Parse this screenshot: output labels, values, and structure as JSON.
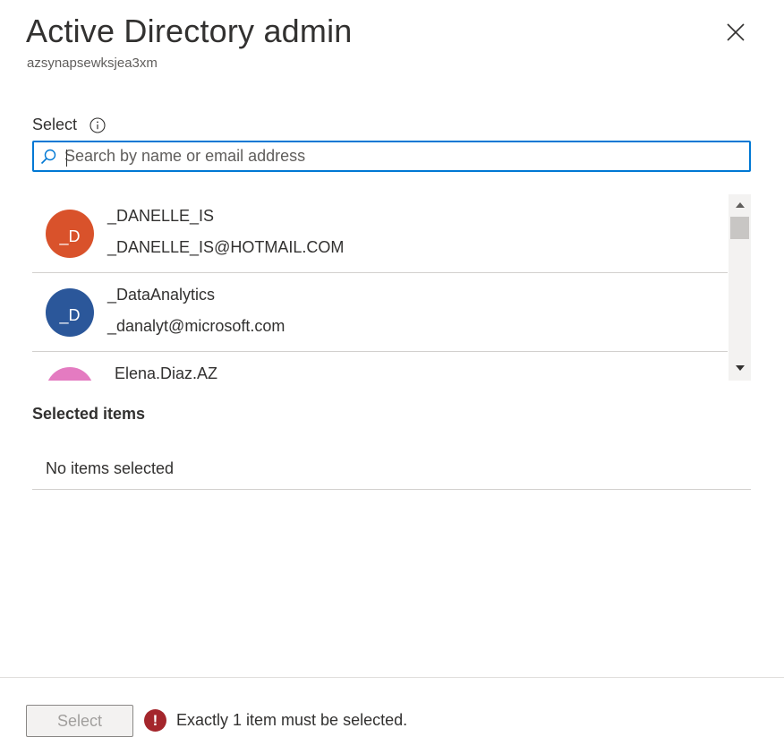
{
  "header": {
    "title": "Active Directory admin",
    "subtitle": "azsynapsewksjea3xm"
  },
  "picker": {
    "label": "Select",
    "search_placeholder": "Search by name or email address",
    "results": [
      {
        "initials": "_D",
        "name": "_DANELLE_IS",
        "email": "_DANELLE_IS@HOTMAIL.COM",
        "color": "#d9522b"
      },
      {
        "initials": "_D",
        "name": "_DataAnalytics",
        "email": "_danalyt@microsoft.com",
        "color": "#2b579a"
      },
      {
        "initials": "",
        "name": "Elena.Diaz.AZ",
        "email": "",
        "color": "#e47bc1"
      }
    ]
  },
  "selected": {
    "heading": "Selected items",
    "empty_text": "No items selected"
  },
  "footer": {
    "select_label": "Select",
    "error_symbol": "!",
    "error_text": "Exactly 1 item must be selected."
  },
  "colors": {
    "accent": "#0078d4",
    "error": "#a4262c"
  }
}
